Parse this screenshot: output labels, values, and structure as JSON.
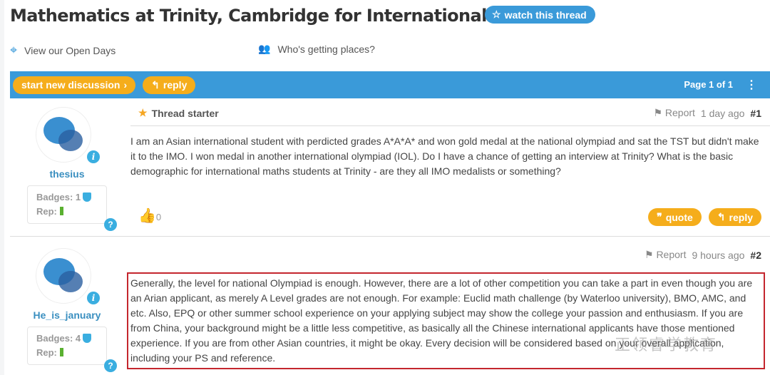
{
  "thread": {
    "title": "Mathematics at Trinity, Cambridge for International Student",
    "watch_label": "watch this thread"
  },
  "links": {
    "open_days": "View our Open Days",
    "getting_places": "Who's getting places?"
  },
  "toolbar": {
    "new_discussion": "start new discussion",
    "reply": "reply",
    "page": "Page 1 of 1"
  },
  "posts": [
    {
      "user": "thesius",
      "badges": "Badges: 1",
      "rep": "Rep:",
      "tag": "Thread starter",
      "report": "Report",
      "time": "1 day ago",
      "num": "#1",
      "text": "I am an Asian international student with perdicted grades A*A*A* and won gold medal at the national olympiad and sat the TST but didn't make it to the IMO. I won medal in another international olympiad (IOL). Do I have a chance of getting an interview at Trinity? What is the basic demographic for international maths students at Trinity - are they all IMO medalists or something?",
      "likes": "0",
      "quote": "quote",
      "reply": "reply"
    },
    {
      "user": "He_is_january",
      "badges": "Badges: 4",
      "rep": "Rep:",
      "report": "Report",
      "time": "9 hours ago",
      "num": "#2",
      "text": "Generally, the level for national Olympiad is enough. However, there are a lot of other competition you can take a part in even though you are an Arian applicant, as merely A Level grades are not enough. For example: Euclid math challenge (by Waterloo university), BMO, AMC, and etc. Also, EPQ or other summer school experience on your applying subject may show the college your passion and enthusiasm. If you are from China, your background might be a little less competitive, as basically all the Chinese international applicants have those mentioned experience. If you are from other Asian countries, it might be okay. Every decision will be considered based on your overall application, including your PS and reference."
    }
  ],
  "watermark": "正领睿学教育",
  "colors": {
    "accent": "#3a9ad9",
    "button": "#f5ad1b",
    "highlight": "#c4262e"
  }
}
